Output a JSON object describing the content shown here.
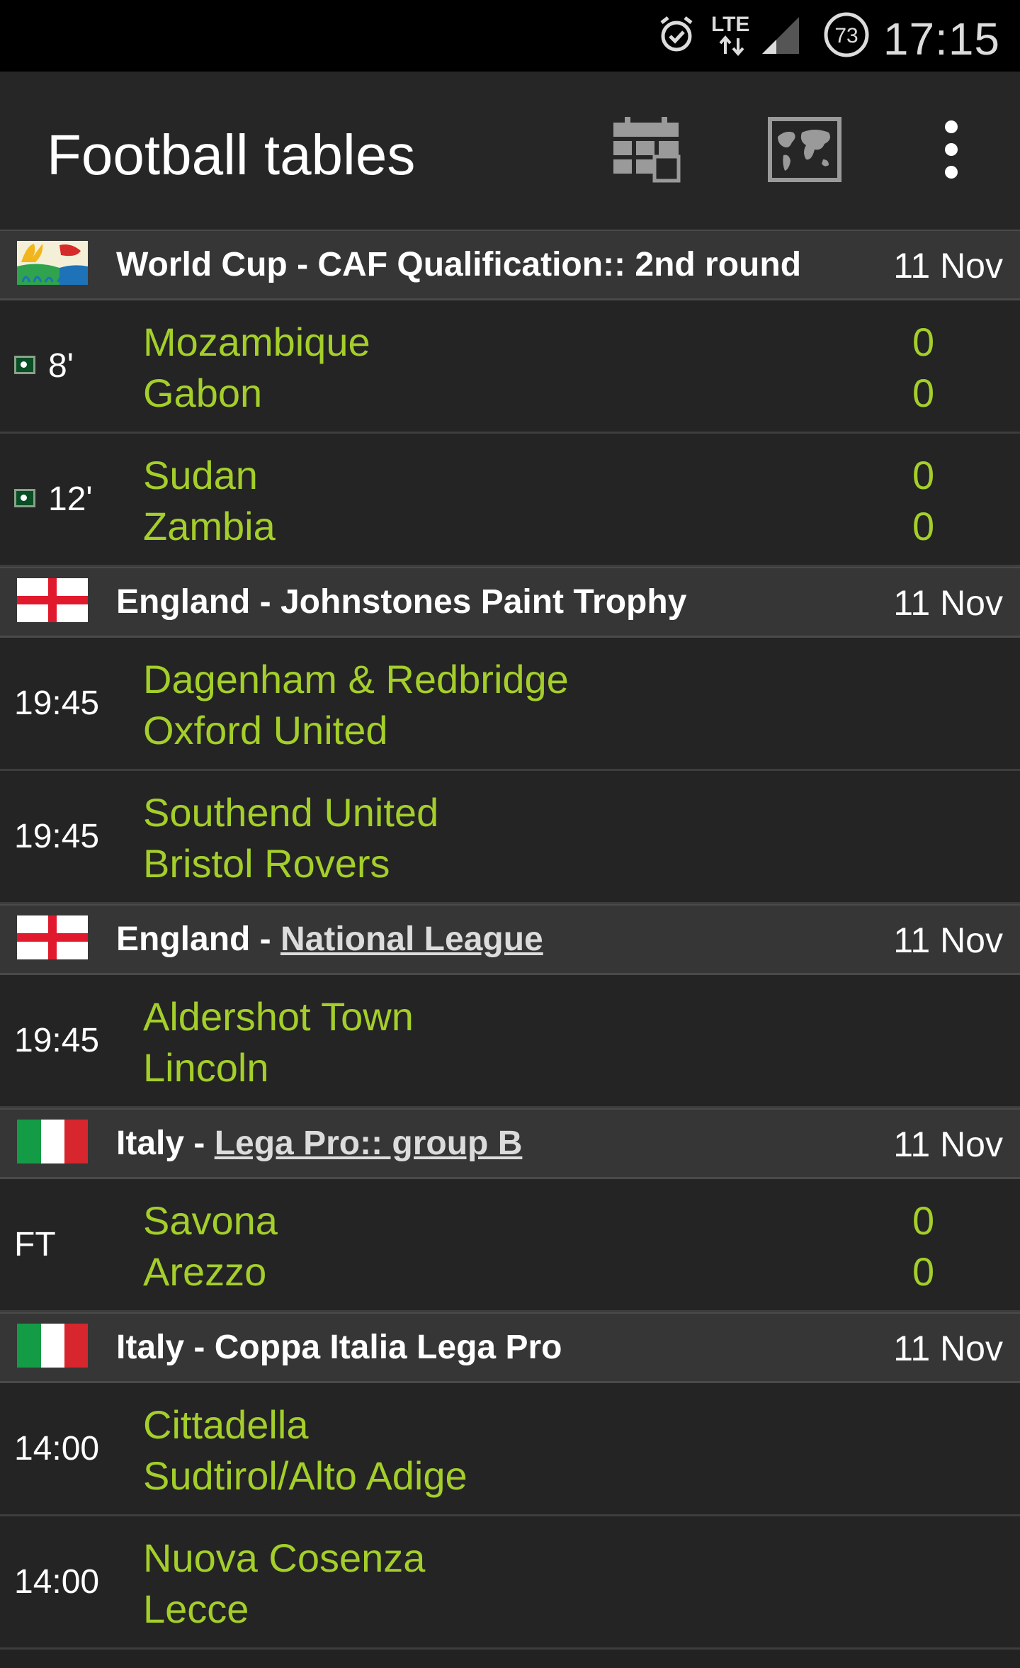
{
  "status_bar": {
    "time": "17:15",
    "network": "LTE",
    "battery_level": "73",
    "icons": [
      "alarm-icon",
      "lte-data-icon",
      "signal-icon",
      "battery-icon"
    ]
  },
  "app_bar": {
    "title": "Football tables",
    "actions": [
      "calendar-icon",
      "world-map-icon",
      "more-options-icon"
    ]
  },
  "colors": {
    "team_green": "#a4cf2a",
    "background": "#222222",
    "header_bg": "#363636"
  },
  "leagues": [
    {
      "flag": "world-cup-brasil-flag",
      "country": "World Cup",
      "separator": " - ",
      "competition": "CAF Qualification:: 2nd round",
      "competition_linked": false,
      "date": "11 Nov",
      "matches": [
        {
          "status": "8'",
          "live": true,
          "home": "Mozambique",
          "away": "Gabon",
          "home_score": "0",
          "away_score": "0"
        },
        {
          "status": "12'",
          "live": true,
          "home": "Sudan",
          "away": "Zambia",
          "home_score": "0",
          "away_score": "0"
        }
      ]
    },
    {
      "flag": "england-flag",
      "country": "England",
      "separator": " - ",
      "competition": "Johnstones Paint Trophy",
      "competition_linked": false,
      "date": "11 Nov",
      "matches": [
        {
          "status": "19:45",
          "live": false,
          "home": "Dagenham & Redbridge",
          "away": "Oxford United",
          "home_score": "",
          "away_score": ""
        },
        {
          "status": "19:45",
          "live": false,
          "home": "Southend United",
          "away": "Bristol Rovers",
          "home_score": "",
          "away_score": ""
        }
      ]
    },
    {
      "flag": "england-flag",
      "country": "England",
      "separator": " - ",
      "competition": "National League",
      "competition_linked": true,
      "date": "11 Nov",
      "matches": [
        {
          "status": "19:45",
          "live": false,
          "home": "Aldershot Town",
          "away": "Lincoln",
          "home_score": "",
          "away_score": ""
        }
      ]
    },
    {
      "flag": "italy-flag",
      "country": "Italy",
      "separator": " - ",
      "competition": "Lega Pro:: group B",
      "competition_linked": true,
      "date": "11 Nov",
      "matches": [
        {
          "status": "FT",
          "live": false,
          "home": "Savona",
          "away": "Arezzo",
          "home_score": "0",
          "away_score": "0"
        }
      ]
    },
    {
      "flag": "italy-flag",
      "country": "Italy",
      "separator": " - ",
      "competition": "Coppa Italia Lega Pro",
      "competition_linked": false,
      "date": "11 Nov",
      "matches": [
        {
          "status": "14:00",
          "live": false,
          "home": "Cittadella",
          "away": "Sudtirol/Alto Adige",
          "home_score": "",
          "away_score": ""
        },
        {
          "status": "14:00",
          "live": false,
          "home": "Nuova Cosenza",
          "away": "Lecce",
          "home_score": "",
          "away_score": ""
        }
      ]
    }
  ]
}
